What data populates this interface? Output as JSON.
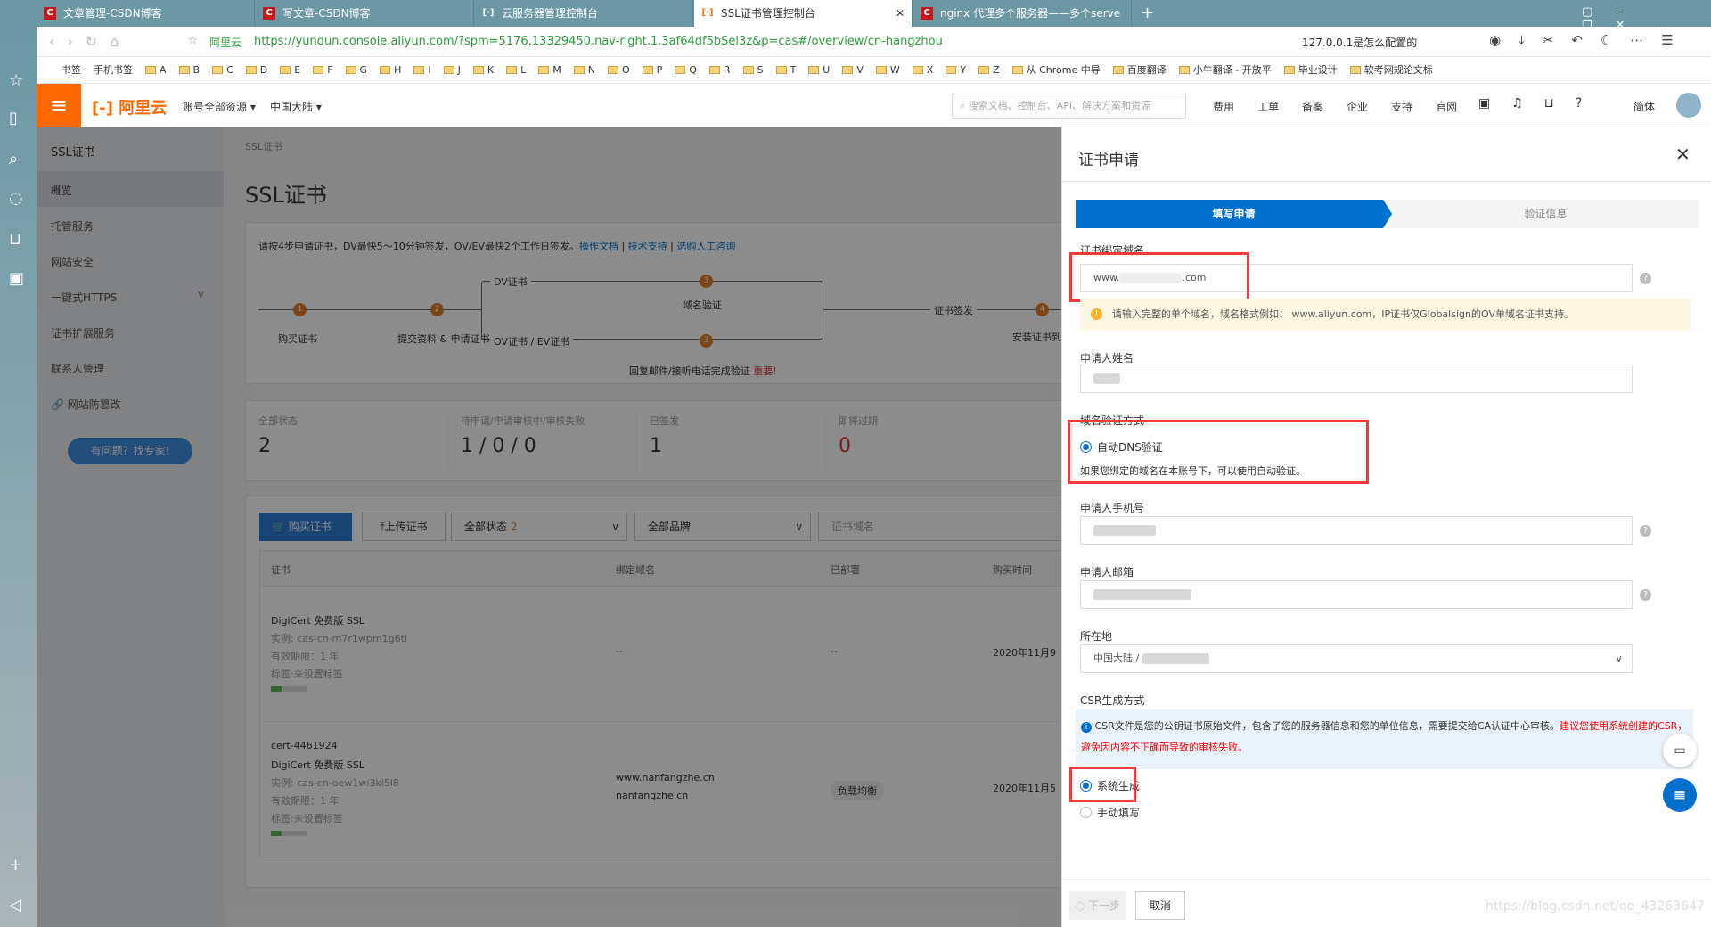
{
  "browser": {
    "tabs": [
      {
        "label": "文章管理-CSDN博客"
      },
      {
        "label": "写文章-CSDN博客"
      },
      {
        "label": "云服务器管理控制台"
      },
      {
        "label": "SSL证书管理控制台",
        "active": true
      },
      {
        "label": "nginx 代理多个服务器——多个serve"
      }
    ],
    "site_label": "阿里云",
    "url": "https://yundun.console.aliyun.com/?spm=5176.13329450.nav-right.1.3af64df5bSel3z&p=cas#/overview/cn-hangzhou",
    "search_text": "127.0.0.1是怎么配置的",
    "bookmarks": [
      "书签",
      "手机书签",
      "A",
      "B",
      "C",
      "D",
      "E",
      "F",
      "G",
      "H",
      "I",
      "J",
      "K",
      "L",
      "M",
      "N",
      "O",
      "P",
      "Q",
      "R",
      "S",
      "T",
      "U",
      "V",
      "W",
      "X",
      "Y",
      "Z",
      "从 Chrome 中导",
      "百度翻译",
      "小牛翻译 - 开放平",
      "毕业设计",
      "软考网规论文标"
    ]
  },
  "topnav": {
    "logo": "阿里云",
    "account": "账号全部资源",
    "region": "中国大陆",
    "search_placeholder": "搜索文档、控制台、API、解决方案和资源",
    "links": [
      "费用",
      "工单",
      "备案",
      "企业",
      "支持",
      "官网"
    ],
    "lang": "简体"
  },
  "sidebar": {
    "title": "SSL证书",
    "items": [
      "概览",
      "托管服务",
      "网站安全",
      "一键式HTTPS",
      "证书扩展服务",
      "联系人管理",
      "网站防篡改"
    ],
    "help_button": "有问题？找专家!"
  },
  "main": {
    "breadcrumb": "SSL证书",
    "title": "SSL证书",
    "intro": "请按4步申请证书，DV最快5～10分钟签发，OV/EV最快2个工作日签发。",
    "intro_links": [
      "操作文档",
      "技术支持",
      "选购人工咨询"
    ],
    "steps": {
      "s1": "购买证书",
      "s2": "提交资料 & 申请证书",
      "dv": "DV证书",
      "ov": "OV证书 / EV证书",
      "s3": "域名验证",
      "s3b": "回复邮件/接听电话完成验证",
      "important": "重要!",
      "issue": "证书签发",
      "s4": "安装证书到网"
    },
    "stats": [
      {
        "label": "全部状态",
        "value": "2"
      },
      {
        "label": "待申请/申请审核中/审核失败",
        "value": "1 / 0 / 0"
      },
      {
        "label": "已签发",
        "value": "1"
      },
      {
        "label": "即将过期",
        "value": "0"
      }
    ],
    "toolbar": {
      "buy": "购买证书",
      "upload": "上传证书",
      "status": "全部状态",
      "status_count": "2",
      "brand": "全部品牌",
      "domain_placeholder": "证书域名"
    },
    "table": {
      "headers": [
        "证书",
        "绑定域名",
        "已部署",
        "购买时间"
      ],
      "rows": [
        {
          "lines": [
            "DigiCert 免费版 SSL",
            "实例: cas-cn-m7r1wpm1g6ti",
            "有效期限：1 年",
            "标签:未设置标签"
          ],
          "domains": [
            "--"
          ],
          "deployed": "--",
          "time": "2020年11月9"
        },
        {
          "lines": [
            "cert-4461924",
            "DigiCert 免费版 SSL",
            "实例: cas-cn-oew1wi3ki5l8",
            "有效期限：1 年",
            "标签:未设置标签"
          ],
          "domains": [
            "www.nanfangzhe.cn",
            "nanfangzhe.cn"
          ],
          "deployed": "负载均衡",
          "time": "2020年11月5"
        }
      ]
    }
  },
  "drawer": {
    "title": "证书申请",
    "steps": [
      "填写申请",
      "验证信息"
    ],
    "domain_label": "证书绑定域名",
    "domain_value_prefix": "www.",
    "domain_value_suffix": ".com",
    "domain_tip": "请输入完整的单个域名，域名格式例如： www.aliyun.com，IP证书仅Globalsign的OV单域名证书支持。",
    "name_label": "申请人姓名",
    "verify_label": "域名验证方式",
    "verify_option": "自动DNS验证",
    "verify_desc": "如果您绑定的域名在本账号下，可以使用自动验证。",
    "phone_label": "申请人手机号",
    "email_label": "申请人邮箱",
    "location_label": "所在地",
    "location_value": "中国大陆 /",
    "csr_label": "CSR生成方式",
    "csr_info": "CSR文件是您的公钥证书原始文件，包含了您的服务器信息和您的单位信息，需要提交给CA认证中心审核。",
    "csr_warn": "建议您使用系统创建的CSR，避免因内容不正确而导致的审核失败。",
    "csr_options": [
      "系统生成",
      "手动填写"
    ],
    "next": "下一步",
    "cancel": "取消"
  },
  "watermark": "https://blog.csdn.net/qq_43263647",
  "colors": {
    "accent": "#0070cc",
    "brand": "#ff6a00",
    "highlight": "#f23a3a"
  }
}
